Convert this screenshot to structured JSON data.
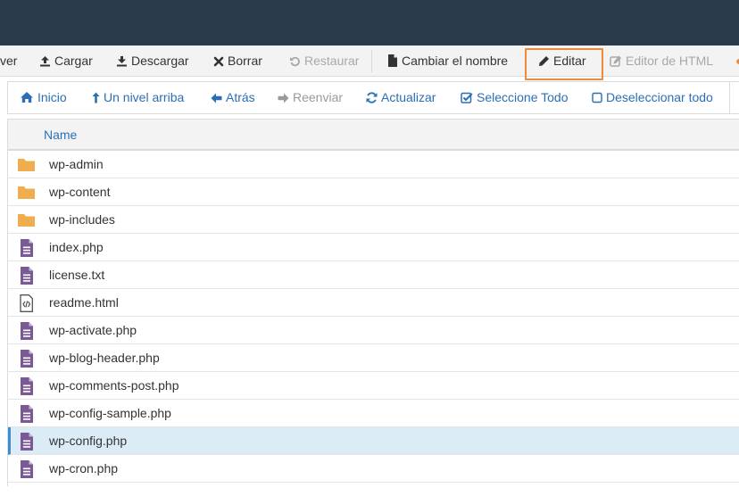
{
  "toolbar": {
    "items": [
      {
        "label": "ver",
        "icon": "none",
        "disabled": false
      },
      {
        "label": "Cargar",
        "icon": "upload-icon",
        "disabled": false
      },
      {
        "label": "Descargar",
        "icon": "download-icon",
        "disabled": false
      },
      {
        "label": "Borrar",
        "icon": "close-icon",
        "disabled": false
      },
      {
        "label": "Restaurar",
        "icon": "undo-icon",
        "disabled": true
      },
      {
        "label": "Cambiar el nombre",
        "icon": "file-icon",
        "disabled": false
      },
      {
        "label": "Editar",
        "icon": "pencil-icon",
        "disabled": false,
        "highlighted": true
      },
      {
        "label": "Editor de HTML",
        "icon": "edit-square-icon",
        "disabled": true
      }
    ]
  },
  "nav": {
    "items": [
      {
        "label": "Inicio",
        "icon": "home-icon",
        "disabled": false
      },
      {
        "label": "Un nivel arriba",
        "icon": "level-up-icon",
        "disabled": false
      },
      {
        "label": "Atrás",
        "icon": "arrow-left-icon",
        "disabled": false
      },
      {
        "label": "Reenviar",
        "icon": "arrow-right-icon",
        "disabled": true
      },
      {
        "label": "Actualizar",
        "icon": "refresh-icon",
        "disabled": false
      },
      {
        "label": "Seleccione Todo",
        "icon": "check-square-icon",
        "disabled": false
      },
      {
        "label": "Deseleccionar todo",
        "icon": "square-icon",
        "disabled": false
      }
    ]
  },
  "table": {
    "column_name": "Name",
    "rows": [
      {
        "name": "wp-admin",
        "type": "folder"
      },
      {
        "name": "wp-content",
        "type": "folder"
      },
      {
        "name": "wp-includes",
        "type": "folder"
      },
      {
        "name": "index.php",
        "type": "file"
      },
      {
        "name": "license.txt",
        "type": "file"
      },
      {
        "name": "readme.html",
        "type": "code"
      },
      {
        "name": "wp-activate.php",
        "type": "file"
      },
      {
        "name": "wp-blog-header.php",
        "type": "file"
      },
      {
        "name": "wp-comments-post.php",
        "type": "file"
      },
      {
        "name": "wp-config-sample.php",
        "type": "file"
      },
      {
        "name": "wp-config.php",
        "type": "file",
        "selected": true
      },
      {
        "name": "wp-cron.php",
        "type": "file"
      }
    ]
  },
  "colors": {
    "topbar": "#293a4a",
    "link": "#2a6fb4",
    "highlight_border": "#ef8a3a",
    "folder": "#f0ad4e",
    "file": "#7a5a94",
    "selected_row": "#dcecf7"
  }
}
